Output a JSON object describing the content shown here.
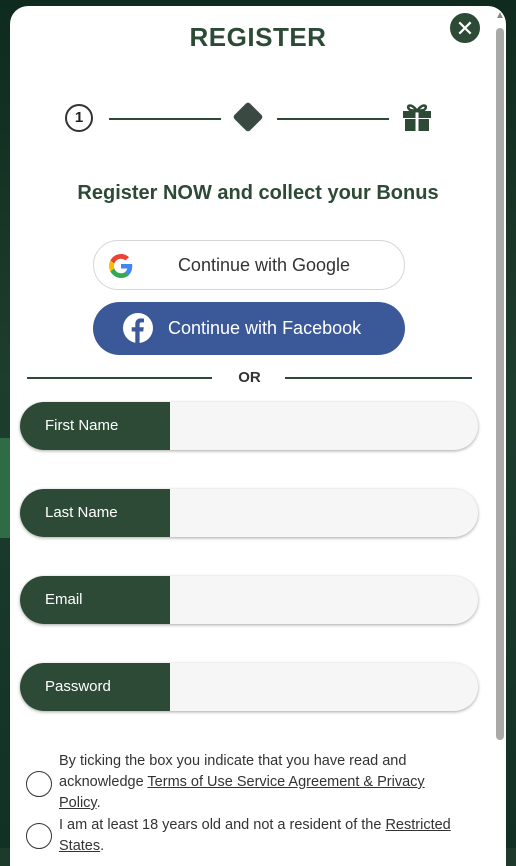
{
  "modal": {
    "title": "REGISTER",
    "close_icon": "close-icon",
    "steps": {
      "step1_number": "1",
      "step2_icon": "diamond-icon",
      "step3_icon": "gift-icon"
    },
    "headline": "Register NOW and collect your Bonus",
    "social": {
      "google_label": "Continue with Google",
      "google_icon": "google-icon",
      "facebook_label": "Continue with Facebook",
      "facebook_icon": "facebook-icon"
    },
    "divider_text": "OR",
    "fields": {
      "first_name": {
        "label": "First Name",
        "value": ""
      },
      "last_name": {
        "label": "Last Name",
        "value": ""
      },
      "email": {
        "label": "Email",
        "value": ""
      },
      "password": {
        "label": "Password",
        "value": ""
      }
    },
    "consent_terms": {
      "text_before": "By ticking the box you indicate that you have read and acknowledge ",
      "link": "Terms of Use Service Agreement & Privacy Policy",
      "text_after": "."
    },
    "consent_age": {
      "text_before": "I am at least 18 years old and not a resident of the ",
      "link": "Restricted States",
      "text_after": "."
    }
  },
  "colors": {
    "brand_green": "#2c4a36",
    "facebook_blue": "#3b5998",
    "field_bg": "#f6f6f6"
  }
}
